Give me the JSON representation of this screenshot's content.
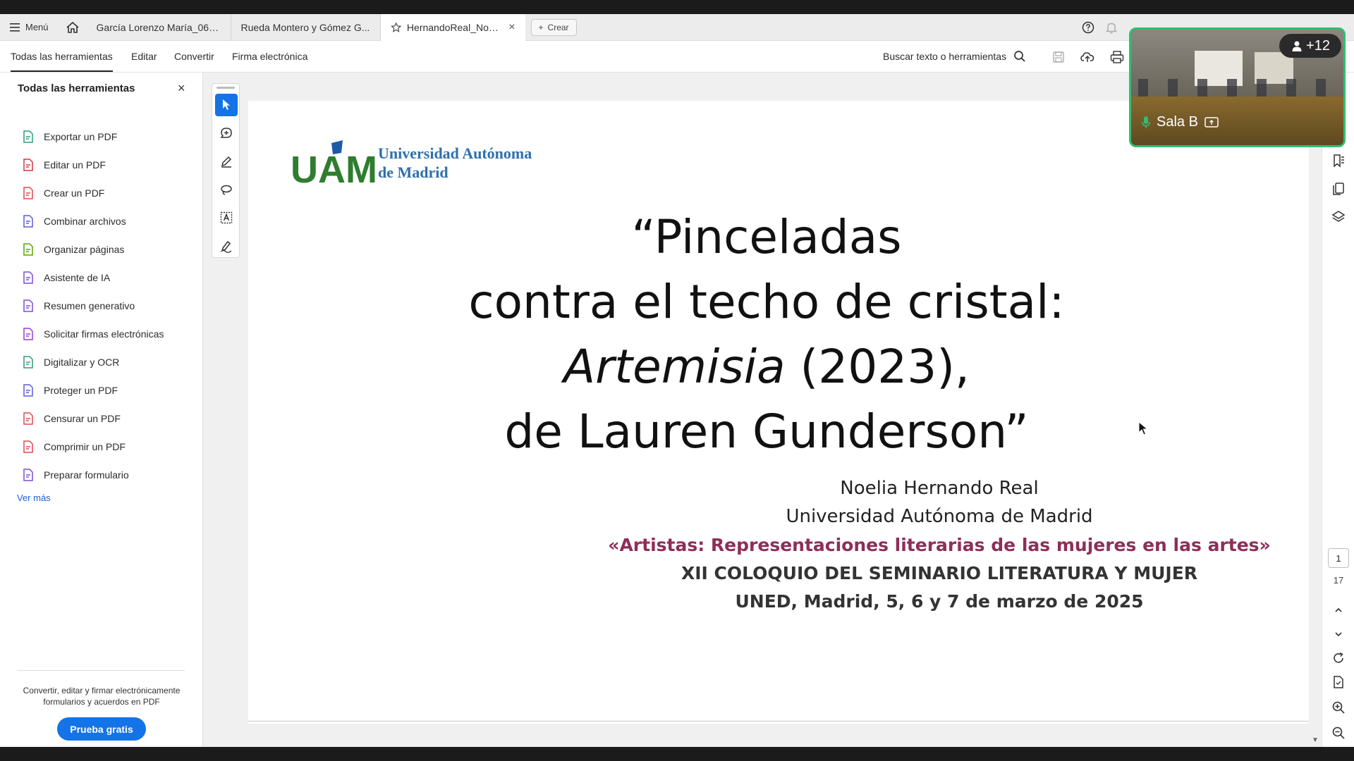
{
  "tabbar": {
    "menu_label": "Menú",
    "tabs": [
      {
        "label": "García Lorenzo María_060..."
      },
      {
        "label": "Rueda Montero y Gómez G..."
      },
      {
        "label": "HernandoReal_Noeli..."
      }
    ],
    "create_label": "Crear"
  },
  "toolbar": {
    "tabs": [
      "Todas las herramientas",
      "Editar",
      "Convertir",
      "Firma electrónica"
    ],
    "search_label": "Buscar texto o herramientas"
  },
  "leftpanel": {
    "title": "Todas las herramientas",
    "tools": [
      {
        "label": "Exportar un PDF",
        "icon": "export-pdf-icon",
        "color": "#2d9d78"
      },
      {
        "label": "Editar un PDF",
        "icon": "edit-pdf-icon",
        "color": "#d7373f"
      },
      {
        "label": "Crear un PDF",
        "icon": "create-pdf-icon",
        "color": "#e34850"
      },
      {
        "label": "Combinar archivos",
        "icon": "combine-files-icon",
        "color": "#5c5ce0"
      },
      {
        "label": "Organizar páginas",
        "icon": "organize-pages-icon",
        "color": "#5aa500"
      },
      {
        "label": "Asistente de IA",
        "icon": "ai-assistant-icon",
        "color": "#7c4dd8"
      },
      {
        "label": "Resumen generativo",
        "icon": "generative-summary-icon",
        "color": "#7c4dd8"
      },
      {
        "label": "Solicitar firmas electrónicas",
        "icon": "request-signatures-icon",
        "color": "#9c3fd0"
      },
      {
        "label": "Digitalizar y OCR",
        "icon": "scan-ocr-icon",
        "color": "#2d9d78"
      },
      {
        "label": "Proteger un PDF",
        "icon": "protect-pdf-icon",
        "color": "#5c5ce0"
      },
      {
        "label": "Censurar un PDF",
        "icon": "redact-pdf-icon",
        "color": "#e34850"
      },
      {
        "label": "Comprimir un PDF",
        "icon": "compress-pdf-icon",
        "color": "#e34850"
      },
      {
        "label": "Preparar formulario",
        "icon": "prepare-form-icon",
        "color": "#7c4dd8"
      }
    ],
    "see_more": "Ver más",
    "promo": "Convertir, editar y firmar electrónicamente formularios y acuerdos en PDF",
    "trial_button": "Prueba gratis"
  },
  "document": {
    "logo_line1": "Universidad Autónoma",
    "logo_line2": "de Madrid",
    "title_line1": "“Pinceladas",
    "title_line2": "contra el techo de cristal:",
    "title_line3_italic": "Artemisia",
    "title_line3_rest": " (2023),",
    "title_line4": "de Lauren Gunderson”",
    "author": "Noelia Hernando Real",
    "university": "Universidad Autónoma de Madrid",
    "conference": "«Artistas: Representaciones literarias de las mujeres en las artes»",
    "colloquium": "XII COLOQUIO DEL SEMINARIO LITERATURA Y MUJER",
    "date": "UNED, Madrid, 5, 6 y 7 de marzo de 2025"
  },
  "pagination": {
    "current": "1",
    "total": "17"
  },
  "video": {
    "room": "Sala B",
    "participants": "+12"
  },
  "colors": {
    "accent": "#1473e6",
    "video_border": "#2fbf71",
    "conference_text": "#8e2e5a",
    "uam_green": "#2f7d2f",
    "uam_blue": "#2e6fae"
  }
}
